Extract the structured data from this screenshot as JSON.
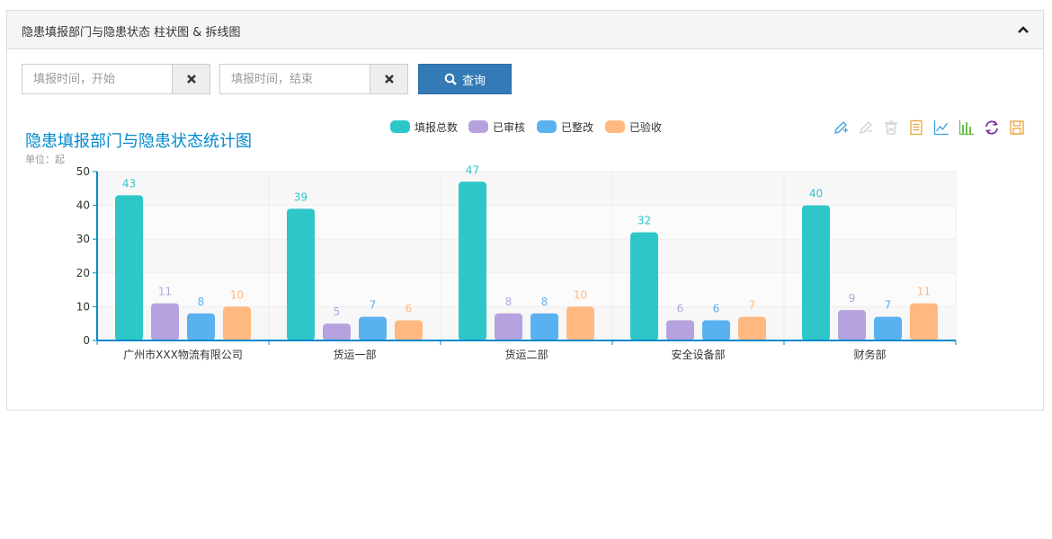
{
  "panel": {
    "title": "隐患填报部门与隐患状态 柱状图 & 拆线图",
    "collapse_icon": "chevron-up-icon"
  },
  "filters": {
    "start_placeholder": "填报时间，开始",
    "end_placeholder": "填报时间，结束",
    "clear_icon": "close-icon",
    "search_label": "查询",
    "search_icon": "search-icon",
    "button_color": "#337ab7"
  },
  "toolbox": [
    {
      "icon": "mark-pen-icon",
      "color": "#3aa0d8"
    },
    {
      "icon": "mark-undo-icon",
      "color": "#cfcfcf"
    },
    {
      "icon": "mark-clear-icon",
      "color": "#cfcfcf"
    },
    {
      "icon": "data-view-icon",
      "color": "#e8a33a"
    },
    {
      "icon": "line-chart-icon",
      "color": "#3aa0d8"
    },
    {
      "icon": "bar-chart-icon",
      "color": "#6cc04a"
    },
    {
      "icon": "restore-icon",
      "color": "#7b2f9e"
    },
    {
      "icon": "save-image-icon",
      "color": "#e8a33a"
    }
  ],
  "chart_data": {
    "type": "bar",
    "title": "隐患填报部门与隐患状态统计图",
    "subtitle": "单位：起",
    "categories": [
      "广州市XXX物流有限公司",
      "货运一部",
      "货运二部",
      "安全设备部",
      "财务部"
    ],
    "series": [
      {
        "name": "填报总数",
        "color": "#2ec7c9",
        "values": [
          43,
          39,
          47,
          32,
          40
        ]
      },
      {
        "name": "已审核",
        "color": "#b6a2de",
        "values": [
          11,
          5,
          8,
          6,
          9
        ]
      },
      {
        "name": "已整改",
        "color": "#5ab1ef",
        "values": [
          8,
          7,
          8,
          6,
          7
        ]
      },
      {
        "name": "已验收",
        "color": "#ffb980",
        "values": [
          10,
          6,
          10,
          7,
          11
        ]
      }
    ],
    "ylim": [
      0,
      50
    ],
    "yticks": [
      0,
      10,
      20,
      30,
      40,
      50
    ],
    "legend_position": "top-center",
    "grid": true,
    "title_color": "#008acd",
    "axis_color": "#008acd"
  }
}
